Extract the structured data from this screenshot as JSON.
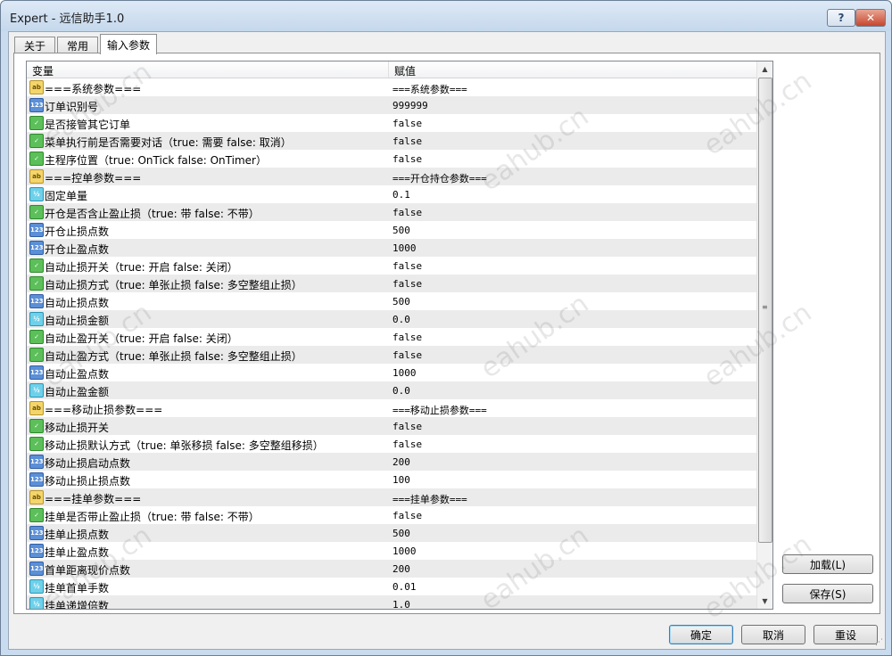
{
  "window": {
    "title": "Expert - 远信助手1.0",
    "help_label": "?",
    "close_label": "✕"
  },
  "tabs": [
    {
      "label": "关于"
    },
    {
      "label": "常用"
    },
    {
      "label": "输入参数"
    }
  ],
  "grid": {
    "col_variable": "变量",
    "col_value": "赋值",
    "rows": [
      {
        "type": "ab",
        "icon": "ab",
        "name": "===系统参数===",
        "value": "===系统参数==="
      },
      {
        "type": "int",
        "icon": "123",
        "name": "订单识别号",
        "value": "999999"
      },
      {
        "type": "bool",
        "icon": "✓",
        "name": "是否接管其它订单",
        "value": "false"
      },
      {
        "type": "bool",
        "icon": "✓",
        "name": "菜单执行前是否需要对话（true: 需要 false: 取消）",
        "value": "false"
      },
      {
        "type": "bool",
        "icon": "✓",
        "name": "主程序位置（true: OnTick  false: OnTimer）",
        "value": "false"
      },
      {
        "type": "ab",
        "icon": "ab",
        "name": "===控单参数===",
        "value": "===开仓持仓参数==="
      },
      {
        "type": "dbl",
        "icon": "½",
        "name": "固定单量",
        "value": "0.1"
      },
      {
        "type": "bool",
        "icon": "✓",
        "name": "开仓是否含止盈止损（true: 带 false: 不带）",
        "value": "false"
      },
      {
        "type": "int",
        "icon": "123",
        "name": "开仓止损点数",
        "value": "500"
      },
      {
        "type": "int",
        "icon": "123",
        "name": "开仓止盈点数",
        "value": "1000"
      },
      {
        "type": "bool",
        "icon": "✓",
        "name": "自动止损开关（true: 开启 false: 关闭）",
        "value": "false"
      },
      {
        "type": "bool",
        "icon": "✓",
        "name": "自动止损方式（true: 单张止损 false: 多空整组止损）",
        "value": "false"
      },
      {
        "type": "int",
        "icon": "123",
        "name": "自动止损点数",
        "value": "500"
      },
      {
        "type": "dbl",
        "icon": "½",
        "name": "自动止损金额",
        "value": "0.0"
      },
      {
        "type": "bool",
        "icon": "✓",
        "name": "自动止盈开关（true: 开启 false: 关闭）",
        "value": "false"
      },
      {
        "type": "bool",
        "icon": "✓",
        "name": "自动止盈方式（true: 单张止损 false: 多空整组止损）",
        "value": "false"
      },
      {
        "type": "int",
        "icon": "123",
        "name": "自动止盈点数",
        "value": "1000"
      },
      {
        "type": "dbl",
        "icon": "½",
        "name": "自动止盈金额",
        "value": "0.0"
      },
      {
        "type": "ab",
        "icon": "ab",
        "name": "===移动止损参数===",
        "value": "===移动止损参数==="
      },
      {
        "type": "bool",
        "icon": "✓",
        "name": "移动止损开关",
        "value": "false"
      },
      {
        "type": "bool",
        "icon": "✓",
        "name": "移动止损默认方式（true: 单张移损 false: 多空整组移损）",
        "value": "false"
      },
      {
        "type": "int",
        "icon": "123",
        "name": "移动止损启动点数",
        "value": "200"
      },
      {
        "type": "int",
        "icon": "123",
        "name": "移动止损止损点数",
        "value": "100"
      },
      {
        "type": "ab",
        "icon": "ab",
        "name": "===挂单参数===",
        "value": "===挂单参数==="
      },
      {
        "type": "bool",
        "icon": "✓",
        "name": "挂单是否带止盈止损（true: 带 false: 不带）",
        "value": "false"
      },
      {
        "type": "int",
        "icon": "123",
        "name": "挂单止损点数",
        "value": "500"
      },
      {
        "type": "int",
        "icon": "123",
        "name": "挂单止盈点数",
        "value": "1000"
      },
      {
        "type": "int",
        "icon": "123",
        "name": "首单距离现价点数",
        "value": "200"
      },
      {
        "type": "dbl",
        "icon": "½",
        "name": "挂单首单手数",
        "value": "0.01"
      },
      {
        "type": "dbl",
        "icon": "½",
        "name": "挂单递增倍数",
        "value": "1.0"
      }
    ]
  },
  "side_buttons": {
    "load": "加载(L)",
    "save": "保存(S)"
  },
  "buttons": {
    "ok": "确定",
    "cancel": "取消",
    "reset": "重设"
  },
  "watermark": "eahub.cn",
  "colors": {
    "title_bar": "#c5d8ec",
    "close": "#c8452f",
    "row_alt": "#ebebeb"
  }
}
